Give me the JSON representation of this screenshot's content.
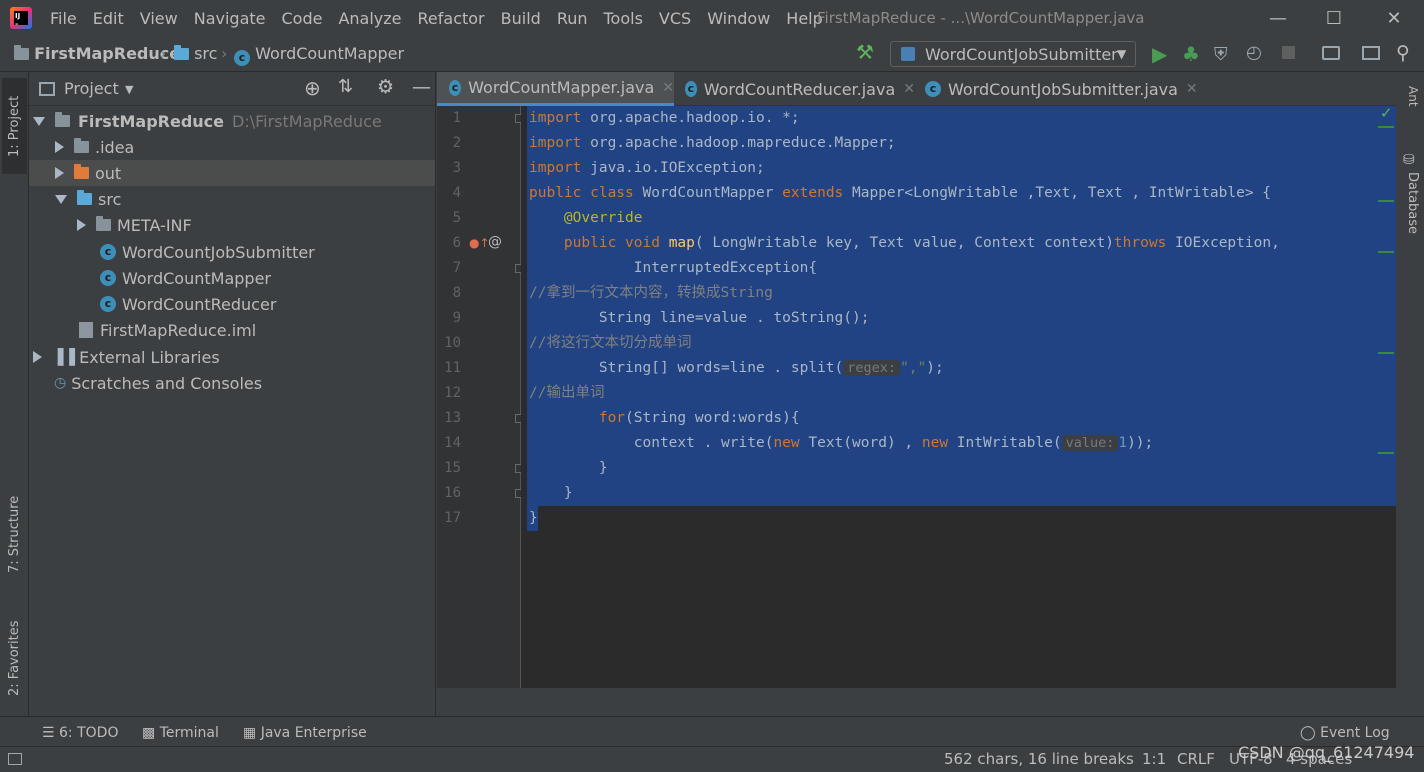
{
  "menu": [
    "File",
    "Edit",
    "View",
    "Navigate",
    "Code",
    "Analyze",
    "Refactor",
    "Build",
    "Run",
    "Tools",
    "VCS",
    "Window",
    "Help"
  ],
  "window_title": "FirstMapReduce - ...\\WordCountMapper.java",
  "breadcrumbs": [
    "FirstMapReduce",
    "src",
    "WordCountMapper"
  ],
  "run_config": "WordCountJobSubmitter",
  "left_tabs": {
    "project": "1: Project",
    "structure": "7: Structure",
    "favorites": "2: Favorites"
  },
  "right_tabs": {
    "database": "Database",
    "ant": "Ant"
  },
  "project_panel": {
    "title": "Project",
    "tree": [
      {
        "label": "FirstMapReduce",
        "path": "D:\\FirstMapReduce"
      },
      {
        "label": ".idea"
      },
      {
        "label": "out"
      },
      {
        "label": "src"
      },
      {
        "label": "META-INF"
      },
      {
        "label": "WordCountJobSubmitter"
      },
      {
        "label": "WordCountMapper"
      },
      {
        "label": "WordCountReducer"
      },
      {
        "label": "FirstMapReduce.iml"
      },
      {
        "label": "External Libraries"
      },
      {
        "label": "Scratches and Consoles"
      }
    ]
  },
  "editor_tabs": [
    "WordCountMapper.java",
    "WordCountReducer.java",
    "WordCountJobSubmitter.java"
  ],
  "code": {
    "line_numbers": [
      "1",
      "2",
      "3",
      "4",
      "5",
      "6",
      "7",
      "8",
      "9",
      "10",
      "11",
      "12",
      "13",
      "14",
      "15",
      "16",
      "17"
    ],
    "l1": [
      "import",
      " org.apache.hadoop.io. *;"
    ],
    "l2": [
      "import",
      " org.apache.hadoop.mapreduce.Mapper;"
    ],
    "l3": [
      "import",
      " java.io.IOException;"
    ],
    "l4": [
      "public class",
      " WordCountMapper ",
      "extends",
      " Mapper<LongWritable ,Text, Text , IntWritable> {"
    ],
    "l5": [
      "    @Override"
    ],
    "l6": [
      "    public void ",
      "map",
      "( LongWritable key, Text value, Context context)",
      "throws",
      " IOException,"
    ],
    "l7": [
      "            InterruptedException{"
    ],
    "l8": [
      "//拿到一行文本内容，转换成String"
    ],
    "l9": [
      "        String line=value . toString();"
    ],
    "l10": [
      "//将这行文本切分成单词"
    ],
    "l11": [
      "        String[] words=line . split(",
      "regex:",
      "\",\"",
      ");"
    ],
    "l12": [
      "//输出单词"
    ],
    "l13": [
      "        for",
      "(String word:words){"
    ],
    "l14": [
      "            context . write(",
      "new",
      " Text(word) , ",
      "new",
      " IntWritable(",
      "value:",
      "1",
      "));"
    ],
    "l15": [
      "        }"
    ],
    "l16": [
      "    }"
    ],
    "l17": [
      "}"
    ]
  },
  "bottom_tools": [
    "6: TODO",
    "Terminal",
    "Java Enterprise",
    "Event Log"
  ],
  "status": {
    "chars": "562 chars, 16 line breaks",
    "position": "1:1",
    "line_sep": "CRLF",
    "encoding": "UTF-8",
    "indent": "4 spaces"
  },
  "watermark": "CSDN @qq_61247494"
}
